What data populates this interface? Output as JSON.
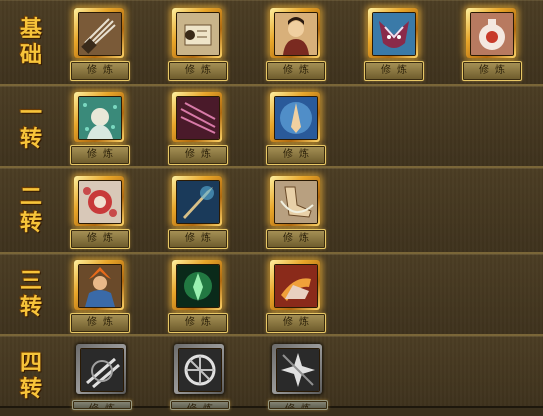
{
  "rows": [
    {
      "label": [
        "基",
        "础"
      ]
    },
    {
      "label": [
        "一",
        "转"
      ]
    },
    {
      "label": [
        "二",
        "转"
      ]
    },
    {
      "label": [
        "三",
        "转"
      ]
    },
    {
      "label": [
        "四",
        "转"
      ]
    }
  ],
  "cultivate_label": "修炼",
  "skills": {
    "r0": [
      {
        "icon": "sword-bundle-icon"
      },
      {
        "icon": "scroll-icon"
      },
      {
        "icon": "warrior-portrait-icon"
      },
      {
        "icon": "demon-mask-icon"
      },
      {
        "icon": "potion-flask-icon"
      }
    ],
    "r1": [
      {
        "icon": "jade-sage-icon"
      },
      {
        "icon": "dark-slash-icon"
      },
      {
        "icon": "praying-hands-icon"
      }
    ],
    "r2": [
      {
        "icon": "red-burst-icon"
      },
      {
        "icon": "flying-blade-icon"
      },
      {
        "icon": "kick-icon"
      }
    ],
    "r3": [
      {
        "icon": "fire-warrior-icon"
      },
      {
        "icon": "green-spirit-icon"
      },
      {
        "icon": "flame-kick-icon"
      }
    ],
    "r4": [
      {
        "icon": "whirl-slash-icon",
        "locked": true
      },
      {
        "icon": "wheel-icon",
        "locked": true
      },
      {
        "icon": "star-strike-icon",
        "locked": true
      }
    ]
  }
}
